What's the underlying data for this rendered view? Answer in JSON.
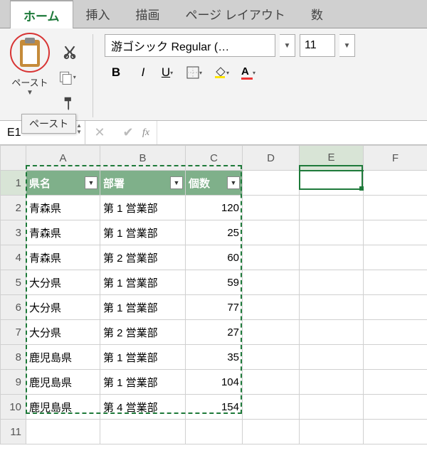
{
  "ribbon": {
    "tabs": [
      "ホーム",
      "挿入",
      "描画",
      "ページ レイアウト",
      "数"
    ],
    "active_tab_index": 0,
    "paste_label": "ペースト",
    "paste_tooltip": "ペースト",
    "font_name": "游ゴシック Regular (…",
    "font_size": "11",
    "bold": "B",
    "italic": "I",
    "underline": "U"
  },
  "namebox": {
    "value": "E1"
  },
  "formula_bar": {
    "fx_label": "fx",
    "value": ""
  },
  "sheet": {
    "columns": [
      "A",
      "B",
      "C",
      "D",
      "E",
      "F"
    ],
    "row_nums": [
      "1",
      "2",
      "3",
      "4",
      "5",
      "6",
      "7",
      "8",
      "9",
      "10",
      "11"
    ],
    "header_row": [
      "県名",
      "部署",
      "個数"
    ],
    "rows": [
      [
        "青森県",
        "第 1 営業部",
        "120"
      ],
      [
        "青森県",
        "第 1 営業部",
        "25"
      ],
      [
        "青森県",
        "第 2 営業部",
        "60"
      ],
      [
        "大分県",
        "第 1 営業部",
        "59"
      ],
      [
        "大分県",
        "第 1 営業部",
        "77"
      ],
      [
        "大分県",
        "第 2 営業部",
        "27"
      ],
      [
        "鹿児島県",
        "第 1 営業部",
        "35"
      ],
      [
        "鹿児島県",
        "第 1 営業部",
        "104"
      ],
      [
        "鹿児島県",
        "第 4 営業部",
        "154"
      ]
    ],
    "active_cell": "E1",
    "copy_range": "A1:C10"
  }
}
